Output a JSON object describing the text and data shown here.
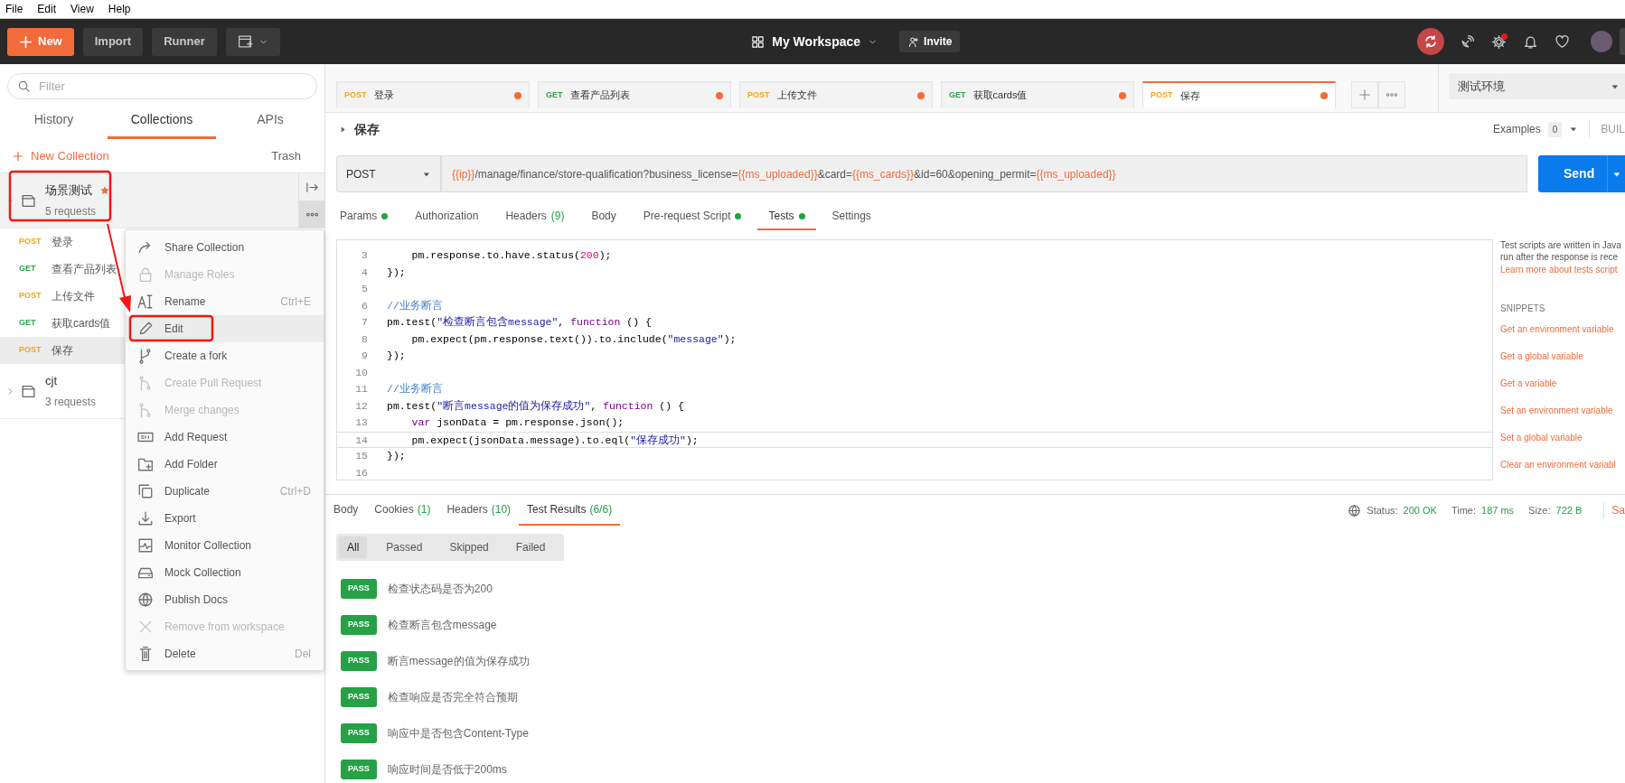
{
  "menubar": [
    "File",
    "Edit",
    "View",
    "Help"
  ],
  "header": {
    "new_button": "New",
    "import_button": "Import",
    "runner_button": "Runner",
    "workspace": "My Workspace",
    "invite": "Invite",
    "settings_alert": true
  },
  "sidebar": {
    "filter_placeholder": "Filter",
    "tabs": [
      {
        "label": "History",
        "selected": false
      },
      {
        "label": "Collections",
        "selected": true
      },
      {
        "label": "APIs",
        "selected": false
      }
    ],
    "new_collection": "New Collection",
    "trash": "Trash",
    "collections": [
      {
        "name": "场景测试",
        "starred": true,
        "expanded": true,
        "selected": true,
        "count": "5 requests",
        "requests": [
          {
            "method": "POST",
            "name": "登录",
            "selected": false
          },
          {
            "method": "GET",
            "name": "查看产品列表",
            "selected": false
          },
          {
            "method": "POST",
            "name": "上传文件",
            "selected": false
          },
          {
            "method": "GET",
            "name": "获取cards值",
            "selected": false
          },
          {
            "method": "POST",
            "name": "保存",
            "selected": true
          }
        ]
      },
      {
        "name": "cjt",
        "starred": false,
        "expanded": false,
        "selected": false,
        "count": "3 requests"
      }
    ]
  },
  "context_menu": {
    "items": [
      {
        "label": "Share Collection",
        "disabled": false,
        "selected": false
      },
      {
        "label": "Manage Roles",
        "disabled": true,
        "selected": false
      },
      {
        "label": "Rename",
        "shortcut": "Ctrl+E",
        "disabled": false,
        "selected": false
      },
      {
        "label": "Edit",
        "disabled": false,
        "selected": true
      },
      {
        "label": "Create a fork",
        "disabled": false,
        "selected": false
      },
      {
        "label": "Create Pull Request",
        "disabled": true,
        "selected": false
      },
      {
        "label": "Merge changes",
        "disabled": true,
        "selected": false
      },
      {
        "label": "Add Request",
        "disabled": false,
        "selected": false
      },
      {
        "label": "Add Folder",
        "disabled": false,
        "selected": false
      },
      {
        "label": "Duplicate",
        "shortcut": "Ctrl+D",
        "disabled": false,
        "selected": false
      },
      {
        "label": "Export",
        "disabled": false,
        "selected": false
      },
      {
        "label": "Monitor Collection",
        "disabled": false,
        "selected": false
      },
      {
        "label": "Mock Collection",
        "disabled": false,
        "selected": false
      },
      {
        "label": "Publish Docs",
        "disabled": false,
        "selected": false
      },
      {
        "label": "Remove from workspace",
        "disabled": true,
        "selected": false
      },
      {
        "label": "Delete",
        "shortcut": "Del",
        "disabled": false,
        "selected": false
      }
    ]
  },
  "request_tabs": [
    {
      "method": "POST",
      "name": "登录",
      "unsaved": true,
      "selected": false
    },
    {
      "method": "GET",
      "name": "查看产品列表",
      "unsaved": true,
      "selected": false
    },
    {
      "method": "POST",
      "name": "上传文件",
      "unsaved": true,
      "selected": false
    },
    {
      "method": "GET",
      "name": "获取cards值",
      "unsaved": true,
      "selected": false
    },
    {
      "method": "POST",
      "name": "保存",
      "unsaved": true,
      "selected": true
    }
  ],
  "environment": "测试环境",
  "request": {
    "name": "保存",
    "examples_label": "Examples",
    "examples_count": "0",
    "build": "BUIL",
    "method": "POST",
    "url": [
      {
        "kind": "var",
        "text": "{{ip}}"
      },
      {
        "kind": "plain",
        "text": "/manage/finance/store-qualification?business_license="
      },
      {
        "kind": "var",
        "text": "{{ms_uploaded}}"
      },
      {
        "kind": "plain",
        "text": "&card="
      },
      {
        "kind": "var",
        "text": "{{ms_cards}}"
      },
      {
        "kind": "plain",
        "text": "&id=60&opening_permit="
      },
      {
        "kind": "var",
        "text": "{{ms_uploaded}}"
      }
    ],
    "send": "Send"
  },
  "section_tabs": [
    {
      "label": "Params",
      "dot": true,
      "selected": false
    },
    {
      "label": "Authorization",
      "dot": false,
      "selected": false
    },
    {
      "label": "Headers",
      "count": "(9)",
      "dot": false,
      "selected": false
    },
    {
      "label": "Body",
      "dot": false,
      "selected": false
    },
    {
      "label": "Pre-request Script",
      "dot": true,
      "selected": false
    },
    {
      "label": "Tests",
      "dot": true,
      "selected": true
    },
    {
      "label": "Settings",
      "dot": false,
      "selected": false
    }
  ],
  "editor": {
    "lines": [
      {
        "number": "3",
        "active": false,
        "tokens": [
          {
            "kind": "plain",
            "text": "    pm.response.to.have.status("
          },
          {
            "kind": "number",
            "text": "200"
          },
          {
            "kind": "plain",
            "text": ");"
          }
        ]
      },
      {
        "number": "4",
        "active": false,
        "tokens": [
          {
            "kind": "plain",
            "text": "});"
          }
        ]
      },
      {
        "number": "5",
        "active": false
      },
      {
        "number": "6",
        "active": false,
        "tokens": [
          {
            "kind": "comment",
            "text": "//业务断言"
          }
        ]
      },
      {
        "number": "7",
        "active": false,
        "tokens": [
          {
            "kind": "plain",
            "text": "pm.test("
          },
          {
            "kind": "string",
            "text": "\"检查断言包含message\""
          },
          {
            "kind": "plain",
            "text": ", "
          },
          {
            "kind": "keyword",
            "text": "function"
          },
          {
            "kind": "plain",
            "text": " () {"
          }
        ]
      },
      {
        "number": "8",
        "active": false,
        "tokens": [
          {
            "kind": "plain",
            "text": "    pm.expect(pm.response.text()).to.include("
          },
          {
            "kind": "string",
            "text": "\"message\""
          },
          {
            "kind": "plain",
            "text": ");"
          }
        ]
      },
      {
        "number": "9",
        "active": false,
        "tokens": [
          {
            "kind": "plain",
            "text": "});"
          }
        ]
      },
      {
        "number": "10",
        "active": false
      },
      {
        "number": "11",
        "active": false,
        "tokens": [
          {
            "kind": "comment",
            "text": "//业务断言"
          }
        ]
      },
      {
        "number": "12",
        "active": false,
        "tokens": [
          {
            "kind": "plain",
            "text": "pm.test("
          },
          {
            "kind": "string",
            "text": "\"断言message的值为保存成功\""
          },
          {
            "kind": "plain",
            "text": ", "
          },
          {
            "kind": "keyword",
            "text": "function"
          },
          {
            "kind": "plain",
            "text": " () {"
          }
        ]
      },
      {
        "number": "13",
        "active": false,
        "tokens": [
          {
            "kind": "keyword",
            "text": "    var"
          },
          {
            "kind": "plain",
            "text": " jsonData = pm.response.json();"
          }
        ]
      },
      {
        "number": "14",
        "active": true,
        "tokens": [
          {
            "kind": "plain",
            "text": "    pm.expect(jsonData.message).to.eql("
          },
          {
            "kind": "string",
            "text": "\"保存成功\""
          },
          {
            "kind": "plain",
            "text": ");"
          }
        ]
      },
      {
        "number": "15",
        "active": false,
        "tokens": [
          {
            "kind": "plain",
            "text": "});"
          }
        ]
      },
      {
        "number": "16",
        "active": false
      }
    ]
  },
  "snippets": {
    "intro": [
      "Test scripts are written in Java",
      "run after the response is rece"
    ],
    "learn_more": "Learn more about tests script",
    "heading": "SNIPPETS",
    "items": [
      "Get an environment variable",
      "Get a global variable",
      "Get a variable",
      "Set an environment variable",
      "Set a global variable",
      "Clear an environment variabl"
    ]
  },
  "response": {
    "tabs": [
      {
        "label": "Body",
        "selected": false
      },
      {
        "label": "Cookies",
        "count": "(1)",
        "selected": false
      },
      {
        "label": "Headers",
        "count": "(10)",
        "selected": false
      },
      {
        "label": "Test Results",
        "count": "(6/6)",
        "selected": true
      }
    ],
    "status_label": "Status:",
    "status": "200 OK",
    "time_label": "Time:",
    "time": "187 ms",
    "size_label": "Size:",
    "size": "722 B",
    "save": "Sa",
    "filters": [
      {
        "label": "All",
        "selected": true
      },
      {
        "label": "Passed",
        "selected": false
      },
      {
        "label": "Skipped",
        "selected": false
      },
      {
        "label": "Failed",
        "selected": false
      }
    ],
    "results": [
      {
        "status": "PASS",
        "name": "检查状态码是否为200"
      },
      {
        "status": "PASS",
        "name": "检查断言包含message"
      },
      {
        "status": "PASS",
        "name": "断言message的值为保存成功"
      },
      {
        "status": "PASS",
        "name": "检查响应是否完全符合预期"
      },
      {
        "status": "PASS",
        "name": "响应中是否包含Content-Type"
      },
      {
        "status": "PASS",
        "name": "响应时间是否低于200ms"
      }
    ]
  }
}
